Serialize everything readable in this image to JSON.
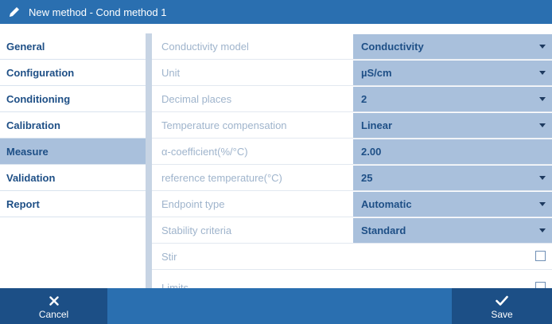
{
  "window": {
    "title": "New method - Cond method 1",
    "icon": "pencil-icon"
  },
  "sidebar": {
    "items": [
      {
        "label": "General"
      },
      {
        "label": "Configuration"
      },
      {
        "label": "Conditioning"
      },
      {
        "label": "Calibration"
      },
      {
        "label": "Measure",
        "active": true
      },
      {
        "label": "Validation"
      },
      {
        "label": "Report"
      }
    ]
  },
  "settings": {
    "rows": [
      {
        "label": "Conductivity model",
        "value": "Conductivity",
        "control": "dropdown"
      },
      {
        "label": "Unit",
        "value": "µS/cm",
        "control": "dropdown"
      },
      {
        "label": "Decimal places",
        "value": "2",
        "control": "dropdown"
      },
      {
        "label": "Temperature compensation",
        "value": "Linear",
        "control": "dropdown"
      },
      {
        "label": "α-coefficient(%/°C)",
        "value": "2.00",
        "control": "input"
      },
      {
        "label": "reference temperature(°C)",
        "value": "25",
        "control": "dropdown"
      },
      {
        "label": "Endpoint type",
        "value": "Automatic",
        "control": "dropdown"
      },
      {
        "label": "Stability criteria",
        "value": "Standard",
        "control": "dropdown"
      },
      {
        "label": "Stir",
        "checked": false,
        "control": "checkbox"
      },
      {
        "label": "Limits",
        "checked": false,
        "control": "checkbox"
      }
    ]
  },
  "footer": {
    "cancel_label": "Cancel",
    "cancel_icon": "close-icon",
    "save_label": "Save",
    "save_icon": "checkmark-icon"
  },
  "colors": {
    "titlebar": "#2a6fb0",
    "footer_button": "#1c4f86",
    "active_item": "#a9c0dc",
    "value_field": "#a9c0dc",
    "label_text": "#9fb4cc",
    "value_text": "#1e4f86"
  }
}
